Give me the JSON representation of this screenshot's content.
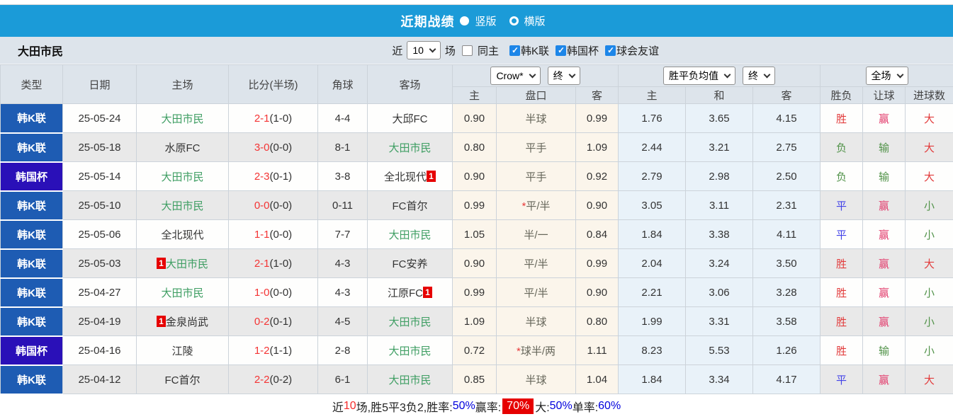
{
  "titlebar": {
    "title": "近期战绩",
    "vertical": {
      "label": "竖版",
      "selected": true
    },
    "horizontal": {
      "label": "横版",
      "selected": false
    }
  },
  "filterbar": {
    "team": "大田市民",
    "near_label": "近",
    "count": "10",
    "games_label": "场",
    "checkboxes": [
      {
        "label": "同主",
        "checked": false
      },
      {
        "label": "韩K联",
        "checked": true
      },
      {
        "label": "韩国杯",
        "checked": true
      },
      {
        "label": "球会友谊",
        "checked": true
      }
    ]
  },
  "table": {
    "columns": [
      "类型",
      "日期",
      "主场",
      "比分(半场)",
      "角球",
      "客场"
    ],
    "selects": {
      "company": "Crow*",
      "company_stage": "终",
      "avg": "胜平负均值",
      "avg_stage": "终",
      "scope": "全场"
    },
    "sub_columns": [
      "主",
      "盘口",
      "客",
      "主",
      "和",
      "客",
      "胜负",
      "让球",
      "进球数"
    ],
    "rows": [
      {
        "type": "韩K联",
        "tclass": "kl",
        "date": "25-05-24",
        "hbadge": "",
        "home": "大田市民",
        "hclass": "focus",
        "score": "2-1",
        "half": "(1-0)",
        "corner": "4-4",
        "away": "大邱FC",
        "aclass": "",
        "abadge": "",
        "o1": "0.90",
        "star": "",
        "pan": "半球",
        "o2": "0.99",
        "a1": "1.76",
        "a2": "3.65",
        "a3": "4.15",
        "r1": "胜",
        "r1c": "red",
        "r2": "赢",
        "r2c": "crimson",
        "r3": "大",
        "r3c": "red"
      },
      {
        "type": "韩K联",
        "tclass": "kl",
        "date": "25-05-18",
        "hbadge": "",
        "home": "水原FC",
        "hclass": "",
        "score": "3-0",
        "half": "(0-0)",
        "corner": "8-1",
        "away": "大田市民",
        "aclass": "focus",
        "abadge": "",
        "o1": "0.80",
        "star": "",
        "pan": "平手",
        "o2": "1.09",
        "a1": "2.44",
        "a2": "3.21",
        "a3": "2.75",
        "r1": "负",
        "r1c": "green",
        "r2": "输",
        "r2c": "green",
        "r3": "大",
        "r3c": "red"
      },
      {
        "type": "韩国杯",
        "tclass": "cup",
        "date": "25-05-14",
        "hbadge": "",
        "home": "大田市民",
        "hclass": "focus",
        "score": "2-3",
        "half": "(0-1)",
        "corner": "3-8",
        "away": "全北现代",
        "aclass": "",
        "abadge": "1",
        "o1": "0.90",
        "star": "",
        "pan": "平手",
        "o2": "0.92",
        "a1": "2.79",
        "a2": "2.98",
        "a3": "2.50",
        "r1": "负",
        "r1c": "green",
        "r2": "输",
        "r2c": "green",
        "r3": "大",
        "r3c": "red"
      },
      {
        "type": "韩K联",
        "tclass": "kl",
        "date": "25-05-10",
        "hbadge": "",
        "home": "大田市民",
        "hclass": "focus",
        "score": "0-0",
        "half": "(0-0)",
        "corner": "0-11",
        "away": "FC首尔",
        "aclass": "",
        "abadge": "",
        "o1": "0.99",
        "star": "*",
        "pan": "平/半",
        "o2": "0.90",
        "a1": "3.05",
        "a2": "3.11",
        "a3": "2.31",
        "r1": "平",
        "r1c": "blue",
        "r2": "赢",
        "r2c": "crimson",
        "r3": "小",
        "r3c": "green"
      },
      {
        "type": "韩K联",
        "tclass": "kl",
        "date": "25-05-06",
        "hbadge": "",
        "home": "全北现代",
        "hclass": "",
        "score": "1-1",
        "half": "(0-0)",
        "corner": "7-7",
        "away": "大田市民",
        "aclass": "focus",
        "abadge": "",
        "o1": "1.05",
        "star": "",
        "pan": "半/一",
        "o2": "0.84",
        "a1": "1.84",
        "a2": "3.38",
        "a3": "4.11",
        "r1": "平",
        "r1c": "blue",
        "r2": "赢",
        "r2c": "crimson",
        "r3": "小",
        "r3c": "green"
      },
      {
        "type": "韩K联",
        "tclass": "kl",
        "date": "25-05-03",
        "hbadge": "1",
        "home": "大田市民",
        "hclass": "focus",
        "score": "2-1",
        "half": "(1-0)",
        "corner": "4-3",
        "away": "FC安养",
        "aclass": "",
        "abadge": "",
        "o1": "0.90",
        "star": "",
        "pan": "平/半",
        "o2": "0.99",
        "a1": "2.04",
        "a2": "3.24",
        "a3": "3.50",
        "r1": "胜",
        "r1c": "red",
        "r2": "赢",
        "r2c": "crimson",
        "r3": "大",
        "r3c": "red"
      },
      {
        "type": "韩K联",
        "tclass": "kl",
        "date": "25-04-27",
        "hbadge": "",
        "home": "大田市民",
        "hclass": "focus",
        "score": "1-0",
        "half": "(0-0)",
        "corner": "4-3",
        "away": "江原FC",
        "aclass": "",
        "abadge": "1",
        "o1": "0.99",
        "star": "",
        "pan": "平/半",
        "o2": "0.90",
        "a1": "2.21",
        "a2": "3.06",
        "a3": "3.28",
        "r1": "胜",
        "r1c": "red",
        "r2": "赢",
        "r2c": "crimson",
        "r3": "小",
        "r3c": "green"
      },
      {
        "type": "韩K联",
        "tclass": "kl",
        "date": "25-04-19",
        "hbadge": "1",
        "home": "金泉尚武",
        "hclass": "",
        "score": "0-2",
        "half": "(0-1)",
        "corner": "4-5",
        "away": "大田市民",
        "aclass": "focus",
        "abadge": "",
        "o1": "1.09",
        "star": "",
        "pan": "半球",
        "o2": "0.80",
        "a1": "1.99",
        "a2": "3.31",
        "a3": "3.58",
        "r1": "胜",
        "r1c": "red",
        "r2": "赢",
        "r2c": "crimson",
        "r3": "小",
        "r3c": "green"
      },
      {
        "type": "韩国杯",
        "tclass": "cup",
        "date": "25-04-16",
        "hbadge": "",
        "home": "江陵",
        "hclass": "",
        "score": "1-2",
        "half": "(1-1)",
        "corner": "2-8",
        "away": "大田市民",
        "aclass": "focus",
        "abadge": "",
        "o1": "0.72",
        "star": "*",
        "pan": "球半/两",
        "o2": "1.11",
        "a1": "8.23",
        "a2": "5.53",
        "a3": "1.26",
        "r1": "胜",
        "r1c": "red",
        "r2": "输",
        "r2c": "green",
        "r3": "小",
        "r3c": "green"
      },
      {
        "type": "韩K联",
        "tclass": "kl",
        "date": "25-04-12",
        "hbadge": "",
        "home": "FC首尔",
        "hclass": "",
        "score": "2-2",
        "half": "(0-2)",
        "corner": "6-1",
        "away": "大田市民",
        "aclass": "focus",
        "abadge": "",
        "o1": "0.85",
        "star": "",
        "pan": "半球",
        "o2": "1.04",
        "a1": "1.84",
        "a2": "3.34",
        "a3": "4.17",
        "r1": "平",
        "r1c": "blue",
        "r2": "赢",
        "r2c": "crimson",
        "r3": "大",
        "r3c": "red"
      }
    ]
  },
  "footer": {
    "near": "近",
    "count": "10",
    "summary": "场,胜5平3负2, ",
    "win_label": "胜率:",
    "win": "50%",
    "ying_label": " 赢率:",
    "ying": "70%",
    "big_label": " 大:",
    "big": "50%",
    "single_label": " 单率:",
    "single": "60%"
  },
  "colors": {
    "accent_blue": "#1b9bd8",
    "kleague_blue": "#1e5cb3",
    "cup_indigo": "#2a10b8",
    "focus_green": "#3f9e63",
    "score_red": "#f43434",
    "result_red": "#e23c3c",
    "result_blue": "#4343e8",
    "result_green": "#52934a",
    "result_crimson": "#e23d6d",
    "badge_red": "#e60000"
  }
}
